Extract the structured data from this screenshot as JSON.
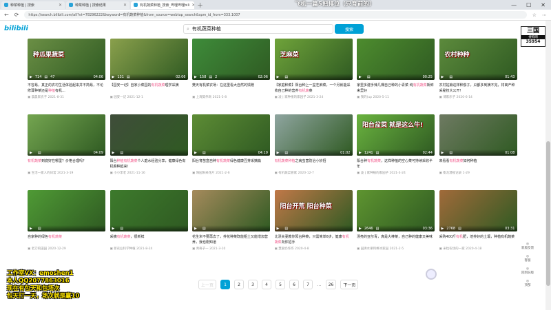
{
  "tabs": [
    {
      "label": "种菜种植 | 搜索",
      "active": false
    },
    {
      "label": "种菜种植 | 搜索结果",
      "active": false
    },
    {
      "label": "有机蔬菜种植_搜索_哔哩哔哩bili",
      "active": true
    }
  ],
  "overlay_title": "飞机一篇5把排位（只育前的）",
  "url": "https://search.bilibili.com/all?vt=78296222&keyword=有机蔬菜种植&from_source=webtop_search&spm_id_from=333.1007",
  "logo": "bilibili",
  "search": {
    "value": "有机蔬菜种植",
    "button": "搜索"
  },
  "cards": [
    {
      "cap": "种瓜果蔬菜",
      "plays": "714",
      "danmaku": "47",
      "dur": "04:06",
      "t1": "不容易，真正的农村生活体验起来并不简易，不论修葺种菜还是",
      "hl": "种植",
      "t2": "有机...",
      "up": "晨晨家农子",
      "date": "2021-8-31",
      "color": "#6b8f45"
    },
    {
      "cap": "",
      "plays": "131",
      "danmaku": "",
      "dur": "02:06",
      "t1": "【园安一记】自家小菜园的",
      "hl": "有机蔬菜",
      "t2": "理学采摘",
      "up": "园安一记",
      "date": "2021-12-1",
      "color": "#8aa04c"
    },
    {
      "cap": "",
      "plays": "158",
      "danmaku": "2",
      "dur": "02:06",
      "t1": "樊天有机菜农场：在这里看大自然的馈赠",
      "hl": "",
      "t2": "",
      "up": "上海樊伟商",
      "date": "2021-5-8",
      "color": "#3e8c3a"
    },
    {
      "cap": "芝麻菜",
      "plays": "",
      "danmaku": "",
      "dur": "",
      "t1": "【家庭种菜】阳台种上一盆芝麻菜，一个月就能采收自己种的营养",
      "hl": "有机蔬",
      "t2": "菜",
      "up": "凌 | 家种植的家园子",
      "date": "2021-3-24",
      "color": "#6fa33a"
    },
    {
      "cap": "",
      "plays": "",
      "danmaku": "",
      "dur": "00:25",
      "t1": "家里多建手辣几棵自己种的小青菜 纯",
      "hl": "有机蔬菜",
      "t2": "新鲜来里好",
      "up": "我的(up",
      "date": "2020-5-11",
      "color": "#4d8c2e"
    },
    {
      "cap": "农村种种",
      "plays": "",
      "danmaku": "",
      "dur": "01:43",
      "t1": "农村姑娘这样种茄子，瓜都多到摘不完，将离产种采秘技大公开！",
      "hl": "",
      "t2": "",
      "up": "博家乐子",
      "date": "2020-6-14",
      "color": "#5c8a3c"
    },
    {
      "cap": "",
      "plays": "",
      "danmaku": "",
      "dur": "04:09",
      "t1": "",
      "hl": "有机蔬菜",
      "t2": "到底好在哪里？价格合理吗？",
      "up": "生活一家人的日常",
      "date": "2021-3-19",
      "color": "#74a550"
    },
    {
      "cap": "",
      "plays": "",
      "danmaku": "",
      "dur": "",
      "t1": "阳台",
      "hl": "种植有机蔬菜",
      "t2": "个人庭水经验分享，健康绿色有机菜种起来！",
      "up": "小小李老",
      "date": "2021-11-16",
      "color": "#3f4d3a"
    },
    {
      "cap": "",
      "plays": "",
      "danmaku": "",
      "dur": "04:19",
      "t1": "阳台育苗盒自种",
      "hl": "有机蔬菜",
      "t2": "绿色健康豆芽采摘篇",
      "up": "阳园阳采花片",
      "date": "2021-2-6",
      "color": "#5d8c35"
    },
    {
      "cap": "",
      "plays": "",
      "danmaku": "",
      "dur": "01:02",
      "t1": "",
      "hl": "有机蔬菜种植",
      "t2": "之病虫害防治小妙招",
      "up": "有机蔬菜管家",
      "date": "2020-12-7",
      "color": "#8fa5a0"
    },
    {
      "cap": "阳台盆菜 就是这么牛!",
      "plays": "1241",
      "danmaku": "",
      "dur": "02:44",
      "t1": "阳台种",
      "hl": "有机蔬菜",
      "t2": "，这样种植的空心菜可持续采收半年",
      "up": "凌 | 家种植的家园子",
      "date": "2021-3-24",
      "color": "#6ab33f"
    },
    {
      "cap": "",
      "plays": "",
      "danmaku": "",
      "dur": "01:08",
      "t1": "来看看",
      "hl": "有机蔬菜",
      "t2": "如何种植",
      "up": "衡龙潜规记录",
      "date": "1-29",
      "color": "#6e7a62"
    },
    {
      "cap": "",
      "plays": "",
      "danmaku": "",
      "dur": "",
      "t1": "自家种的绿色",
      "hl": "有机蔬菜",
      "t2": "",
      "up": "老刀的田园",
      "date": "2020-12-29",
      "color": "#4f9a35"
    },
    {
      "cap": "",
      "plays": "",
      "danmaku": "",
      "dur": "",
      "t1": "采摘",
      "hl": "有机蔬菜",
      "t2": "，很新鲜",
      "up": "新农业科学种植",
      "date": "2021-8-24",
      "color": "#3d7a2c"
    },
    {
      "cap": "",
      "plays": "",
      "danmaku": "",
      "dur": "",
      "t1": "花生米不要再去了，养花种菜既能粗土又能增加营养，我也刚知道",
      "hl": "",
      "t2": "",
      "up": "青奇子一",
      "date": "2021-3-10",
      "color": "#a58a5c"
    },
    {
      "cap": "阳台开荒 阳台种菜",
      "plays": "",
      "danmaku": "",
      "dur": "",
      "t1": "北漂夫妻教你阳台种菜，只需简单6步，健康",
      "hl": "有机蔬菜",
      "t2": "向你招手",
      "up": "慧爱奶作作",
      "date": "2020-4-8",
      "color": "#c07848"
    },
    {
      "cap": "",
      "plays": "2646",
      "danmaku": "",
      "dur": "03:36",
      "t1": "漂亮的亚尔青，真是大棒菜，自己种的健康又美味",
      "hl": "",
      "t2": "",
      "up": "园清水果和棒冰家园",
      "date": "2021-2-5",
      "color": "#5e9430"
    },
    {
      "cap": "",
      "plays": "2768",
      "danmaku": "",
      "dur": "03:31",
      "t1": "采购400斤",
      "hl": "有机",
      "t2": "肥，培养好的土壤，种植有机蔬菜",
      "up": "米粒农场的一家",
      "date": "2020-4-18",
      "color": "#a06a3a"
    }
  ],
  "pagination": {
    "prev": "上一页",
    "pages": [
      "1",
      "2",
      "3",
      "4",
      "5",
      "6",
      "7"
    ],
    "ellipsis": "...",
    "last": "26",
    "next": "下一页"
  },
  "promo": [
    "工作室VX：emoshen1",
    "本人QQ2077863016",
    "现在有包天和包场次",
    "包天打一天，场次就是赢10"
  ],
  "top_badge": {
    "line1": "三国",
    "line2": "搜狗网",
    "line3": "35954"
  },
  "side_items": [
    "新版反馈",
    "客服",
    "回到旧版",
    "顶部"
  ],
  "colors": {
    "accent": "#00a1d6",
    "highlight": "#f25d8e",
    "promo": "#ffe600"
  }
}
